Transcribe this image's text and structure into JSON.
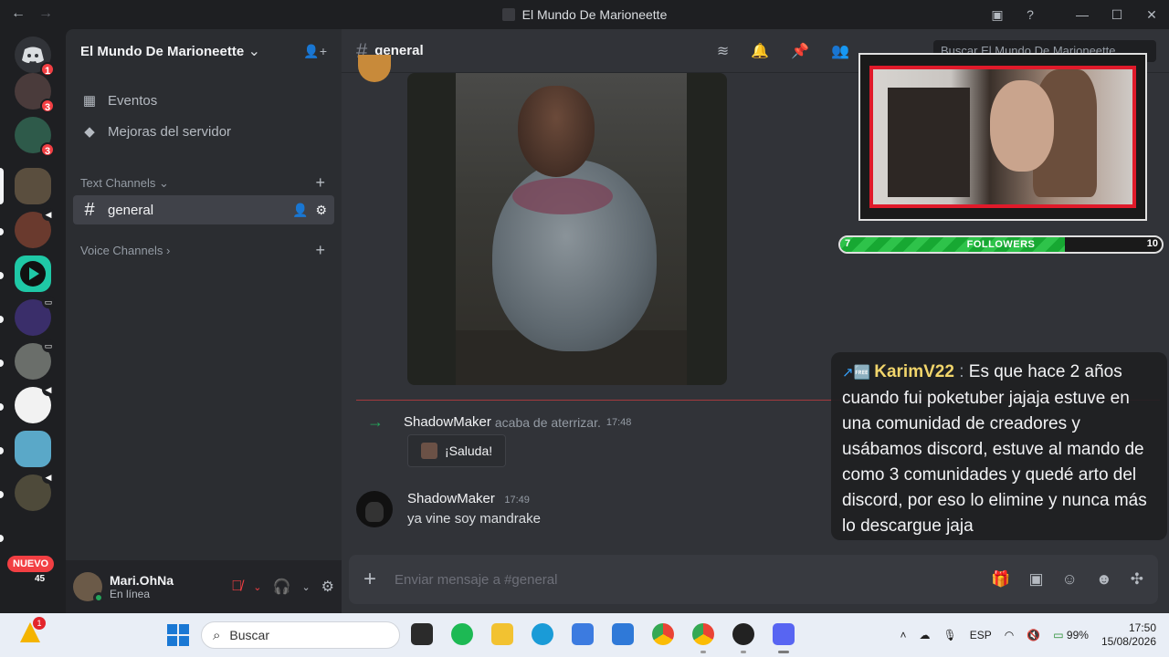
{
  "titlebar": {
    "back": "←",
    "forward": "→",
    "title": "El Mundo De Marioneette",
    "inbox_icon": "▣",
    "help_icon": "?",
    "minimize": "—",
    "maximize": "☐",
    "close": "✕"
  },
  "servers": {
    "items": [
      {
        "name": "discord-home",
        "badge": "1",
        "color": "#313338"
      },
      {
        "name": "server-1",
        "badge": "3",
        "color": "#4a3b3b"
      },
      {
        "name": "server-2",
        "badge": "3",
        "color": "#2e5a4a"
      },
      {
        "name": "server-3",
        "badge": "",
        "color": "#5a4e3e"
      },
      {
        "name": "server-4",
        "badge": "",
        "color": "#6a3a2e"
      },
      {
        "name": "server-5",
        "badge": "",
        "color": "#1fc8a6"
      },
      {
        "name": "server-6",
        "badge": "",
        "color": "#3a2e6a"
      },
      {
        "name": "server-7",
        "badge": "",
        "color": "#6a6e6a"
      },
      {
        "name": "server-8",
        "badge": "",
        "color": "#f2f2f2"
      },
      {
        "name": "server-9",
        "badge": "",
        "color": "#5aa8c8"
      },
      {
        "name": "server-10",
        "badge": "",
        "color": "#4e4a3a"
      }
    ],
    "new_label": "NUEVO",
    "new_count": "45"
  },
  "sidebar": {
    "server_name": "El Mundo De Marioneette",
    "chevron": "⌄",
    "invite_icon": "👤+",
    "items": [
      {
        "icon": "▦",
        "label": "Eventos"
      },
      {
        "icon": "◆",
        "label": "Mejoras del servidor"
      }
    ],
    "text_category": "Text Channels",
    "text_category_chevron": "⌄",
    "active_channel": "general",
    "voice_category": "Voice Channels",
    "voice_category_chevron": "›",
    "plus": "+"
  },
  "user": {
    "name": "Mari.OhNa",
    "status": "En línea"
  },
  "chat": {
    "channel": "general",
    "search_placeholder": "Buscar El Mundo De Marioneette",
    "system_author": "ShadowMaker",
    "system_text": "acaba de aterrizar.",
    "system_time": "17:48",
    "wave_label": "¡Saluda!",
    "message_author": "ShadowMaker",
    "message_time": "17:49",
    "message_text": "ya vine soy mandrake",
    "composer_placeholder": "Enviar mensaje a #general"
  },
  "stream_overlay": {
    "followers_label": "FOLLOWERS",
    "followers_current": "7",
    "followers_goal": "10",
    "followers_progress": 0.7,
    "chat_badges": "↗🆓",
    "chat_user": "KarimV22",
    "chat_sep": ":",
    "chat_text": "Es que hace 2 años cuando fui poketuber jajaja estuve en una comunidad de creadores y usábamos discord, estuve al mando de como 3 comunidades y quedé arto del discord, por eso lo elimine y nunca más lo descargue jaja"
  },
  "taskbar": {
    "weather_badge": "1",
    "search_label": "Buscar",
    "lang": "ESP",
    "battery": "99%",
    "time": "17:50",
    "date": "15/08/2026"
  },
  "colors": {
    "accent": "#5865f2",
    "online": "#23a55a",
    "danger": "#f23f43"
  }
}
